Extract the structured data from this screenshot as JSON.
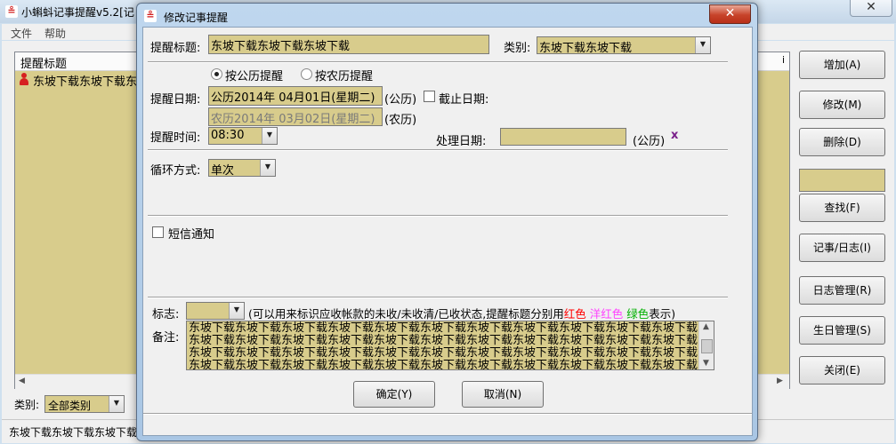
{
  "main": {
    "title": "小蝌蚪记事提醒v5.2[记",
    "menu": [
      "文件",
      "帮助"
    ],
    "list": {
      "header": "提醒标题",
      "rows": [
        "东坡下载东坡下载东坡"
      ]
    },
    "category_label": "类别:",
    "category_value": "全部类别",
    "status_text": "东坡下载东坡下载东坡下载",
    "side_buttons": [
      "增加(A)",
      "修改(M)",
      "删除(D)",
      "查找(F)",
      "记事/日志(I)",
      "日志管理(R)",
      "生日管理(S)",
      "关闭(E)"
    ]
  },
  "dialog": {
    "title": "修改记事提醒",
    "close_glyph": "✕",
    "reminder_title_label": "提醒标题:",
    "reminder_title_value": "东坡下载东坡下载东坡下载",
    "category_label": "类别:",
    "category_value": "东坡下载东坡下载",
    "radio_solar": "按公历提醒",
    "radio_lunar": "按农历提醒",
    "date_label": "提醒日期:",
    "solar_date": "公历2014年 04月01日(星期二)",
    "solar_suffix": "(公历)",
    "deadline_label": "截止日期:",
    "lunar_date": "农历2014年 03月02日(星期二)",
    "lunar_suffix": "(农历)",
    "time_label": "提醒时间:",
    "time_value": "08:30",
    "process_date_label": "处理日期:",
    "process_suffix": "(公历)",
    "process_clear": "x",
    "cycle_label": "循环方式:",
    "cycle_value": "单次",
    "sms_label": "短信通知",
    "flag_label": "标志:",
    "flag_hint_prefix": "(可以用来标识应收帐款的未收/未收清/已收状态,提醒标题分别用",
    "flag_red": "红色",
    "flag_magenta": "洋红色",
    "flag_green": "绿色",
    "flag_hint_suffix": "表示)",
    "remark_label": "备注:",
    "remark_text": "东坡下载东坡下载东坡下载东坡下载东坡下载东坡下载东坡下载东坡下载东坡下载东坡下载东坡下载东坡下载东坡下载东坡下载东坡下载东坡下载东坡下载东坡下载东坡下载东坡下载东坡下载东坡下载东坡下载东坡下载东坡下载东坡下载东坡下载东坡下载东坡下载东坡下载东坡下载东坡下载东坡下载东坡下载东坡下载东坡下载东坡下载东坡下载东坡下载东坡下载东坡下载东坡下载东坡下载东坡下载东坡下载东坡",
    "ok_button": "确定(Y)",
    "cancel_button": "取消(N)"
  },
  "colors": {
    "field_bg": "#d8cc8c",
    "red": "#ff0000",
    "magenta": "#ff40ff",
    "green": "#00b000"
  }
}
